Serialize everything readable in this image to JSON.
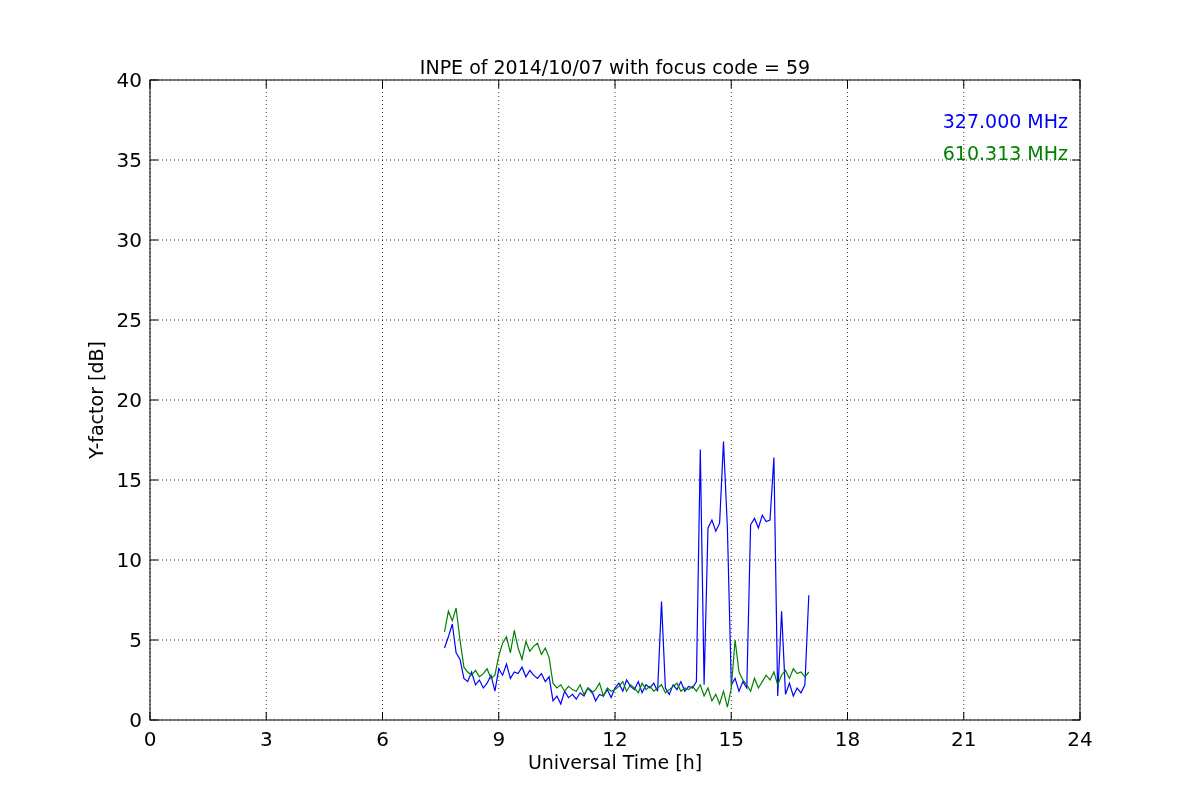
{
  "chart_data": {
    "type": "line",
    "grid": true,
    "title": "INPE of 2014/10/07 with focus code = 59",
    "xlabel": "Universal Time [h]",
    "ylabel": "Y-factor [dB]",
    "xlim": [
      0,
      24
    ],
    "ylim": [
      0,
      40
    ],
    "xticks": [
      0,
      3,
      6,
      9,
      12,
      15,
      18,
      21,
      24
    ],
    "yticks": [
      0,
      5,
      10,
      15,
      20,
      25,
      30,
      35,
      40
    ],
    "x": [
      7.6,
      7.7,
      7.8,
      7.9,
      8.0,
      8.1,
      8.2,
      8.3,
      8.4,
      8.5,
      8.6,
      8.7,
      8.8,
      8.9,
      9.0,
      9.1,
      9.2,
      9.3,
      9.4,
      9.5,
      9.6,
      9.7,
      9.8,
      9.9,
      10.0,
      10.1,
      10.2,
      10.3,
      10.4,
      10.5,
      10.6,
      10.7,
      10.8,
      10.9,
      11.0,
      11.1,
      11.2,
      11.3,
      11.4,
      11.5,
      11.6,
      11.7,
      11.8,
      11.9,
      12.0,
      12.1,
      12.2,
      12.3,
      12.4,
      12.5,
      12.6,
      12.7,
      12.8,
      12.9,
      13.0,
      13.1,
      13.2,
      13.3,
      13.4,
      13.5,
      13.6,
      13.7,
      13.8,
      13.9,
      14.0,
      14.1,
      14.2,
      14.3,
      14.4,
      14.5,
      14.6,
      14.7,
      14.8,
      14.9,
      15.0,
      15.1,
      15.2,
      15.3,
      15.4,
      15.5,
      15.6,
      15.7,
      15.8,
      15.9,
      16.0,
      16.1,
      16.2,
      16.3,
      16.4,
      16.5,
      16.6,
      16.7,
      16.8,
      16.9,
      17.0
    ],
    "series": [
      {
        "name": "327.000 MHz",
        "color": "#0000ff",
        "values": [
          4.5,
          5.2,
          6.0,
          4.2,
          3.8,
          2.6,
          2.4,
          3.0,
          2.2,
          2.5,
          2.0,
          2.3,
          2.8,
          1.8,
          3.2,
          2.8,
          3.5,
          2.6,
          3.0,
          2.9,
          3.3,
          2.7,
          3.1,
          2.8,
          2.6,
          2.9,
          2.4,
          2.7,
          1.2,
          1.5,
          1.0,
          1.8,
          1.4,
          1.6,
          1.3,
          1.7,
          1.5,
          2.0,
          1.8,
          1.2,
          1.6,
          1.5,
          1.9,
          1.4,
          2.0,
          2.3,
          1.8,
          2.5,
          2.1,
          1.9,
          2.4,
          1.7,
          2.2,
          2.0,
          2.3,
          1.8,
          7.4,
          2.0,
          1.6,
          2.2,
          1.9,
          2.4,
          1.8,
          2.1,
          2.0,
          2.4,
          16.9,
          2.2,
          12.0,
          12.5,
          11.8,
          12.3,
          17.4,
          12.0,
          2.2,
          2.6,
          1.8,
          2.4,
          2.0,
          12.2,
          12.6,
          12.0,
          12.8,
          12.4,
          12.5,
          16.4,
          1.5,
          6.8,
          1.6,
          2.3,
          1.5,
          2.0,
          1.7,
          2.2,
          7.8
        ]
      },
      {
        "name": "610.313 MHz",
        "color": "#008000",
        "values": [
          5.5,
          6.8,
          6.2,
          7.0,
          5.0,
          3.3,
          3.0,
          2.8,
          3.1,
          2.7,
          2.9,
          3.2,
          2.6,
          2.8,
          4.0,
          4.8,
          5.2,
          4.2,
          5.6,
          4.5,
          3.8,
          4.9,
          4.3,
          4.6,
          4.8,
          4.1,
          4.5,
          3.9,
          2.3,
          2.0,
          2.2,
          1.8,
          2.1,
          1.9,
          1.8,
          2.2,
          1.6,
          2.0,
          1.7,
          1.9,
          2.3,
          1.5,
          2.0,
          1.8,
          1.9,
          2.1,
          2.4,
          1.8,
          2.2,
          2.0,
          1.7,
          2.3,
          1.9,
          2.1,
          1.8,
          2.0,
          2.2,
          1.7,
          1.9,
          2.1,
          2.3,
          1.8,
          2.0,
          1.9,
          2.1,
          1.8,
          2.2,
          1.5,
          2.0,
          1.2,
          1.6,
          1.0,
          1.8,
          0.8,
          2.0,
          5.0,
          3.0,
          2.5,
          2.2,
          1.8,
          2.6,
          2.0,
          2.4,
          2.8,
          2.5,
          3.0,
          2.2,
          2.8,
          3.1,
          2.6,
          3.2,
          2.9,
          3.0,
          2.7,
          3.0
        ]
      }
    ]
  }
}
